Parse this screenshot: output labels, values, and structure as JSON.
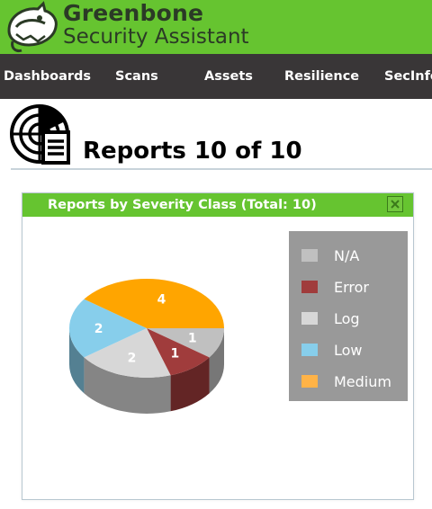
{
  "app": {
    "brand_name": "Greenbone",
    "brand_sub": "Security Assistant"
  },
  "nav": {
    "items": [
      {
        "label": "Dashboards"
      },
      {
        "label": "Scans"
      },
      {
        "label": "Assets"
      },
      {
        "label": "Resilience"
      },
      {
        "label": "SecInfo"
      }
    ]
  },
  "page": {
    "title": "Reports 10 of 10"
  },
  "panel": {
    "title": "Reports by Severity Class (Total: 10)",
    "close_icon": "close-icon"
  },
  "colors": {
    "brand_green": "#66c430",
    "nav_bg": "#393637",
    "legend_bg": "#999999"
  },
  "chart_data": {
    "type": "pie",
    "style": "3d",
    "title": "Reports by Severity Class (Total: 10)",
    "categories": [
      "N/A",
      "Error",
      "Log",
      "Low",
      "Medium"
    ],
    "values": [
      1,
      1,
      2,
      2,
      4
    ],
    "colors": [
      "#c0c0c0",
      "#a03c3c",
      "#d7d7d7",
      "#87ceeb",
      "#ffa500"
    ],
    "legend_colors": [
      "#c0c0c0",
      "#a03c3c",
      "#d7d7d7",
      "#87ceeb",
      "#ffb347"
    ],
    "legend_placement": "right"
  }
}
